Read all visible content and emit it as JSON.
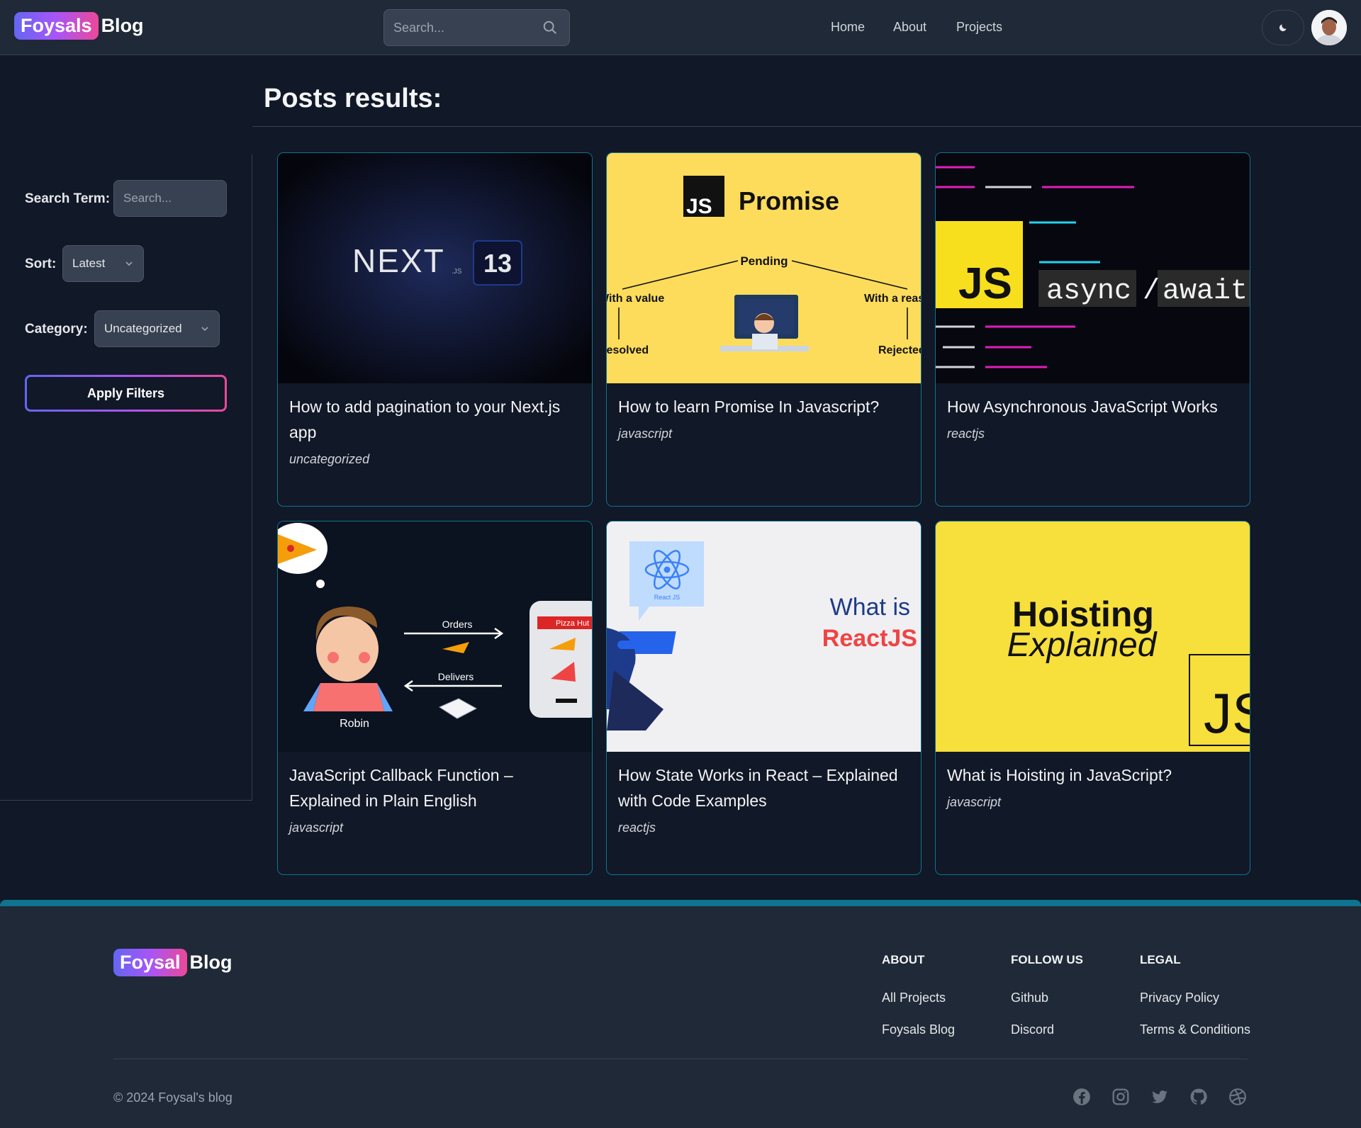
{
  "header": {
    "logo_badge": "Foysals",
    "logo_text": "Blog",
    "search_placeholder": "Search...",
    "nav": [
      "Home",
      "About",
      "Projects"
    ]
  },
  "sidebar": {
    "search_label": "Search Term:",
    "search_placeholder": "Search...",
    "sort_label": "Sort:",
    "sort_value": "Latest",
    "category_label": "Category:",
    "category_value": "Uncategorized",
    "apply_label": "Apply Filters"
  },
  "main": {
    "title": "Posts results:",
    "posts": [
      {
        "title": "How to add pagination to your Next.js app",
        "category": "uncategorized",
        "thumb": "nextjs-13-banner"
      },
      {
        "title": "How to learn Promise In Javascript?",
        "category": "javascript",
        "thumb": "js-promise-diagram"
      },
      {
        "title": "How Asynchronous JavaScript Works",
        "category": "reactjs",
        "thumb": "js-async-await"
      },
      {
        "title": "JavaScript Callback Function –Explained in Plain English",
        "category": "javascript",
        "thumb": "pizza-callback-illustration"
      },
      {
        "title": "How State Works in React – Explained with Code Examples",
        "category": "reactjs",
        "thumb": "what-is-reactjs"
      },
      {
        "title": "What is Hoisting in JavaScript?",
        "category": "javascript",
        "thumb": "hoisting-explained"
      }
    ],
    "thumb_text": {
      "next": "NEXT",
      "next_js": ".JS",
      "next_ver": "13",
      "js": "JS",
      "promise": "Promise",
      "pending": "Pending",
      "with_value": "With a value",
      "with_reason": "With a reason",
      "resolved": "Resolved",
      "rejected": "Rejected",
      "async": "async",
      "slash": "/",
      "await": "await",
      "orders": "Orders",
      "delivers": "Delivers",
      "robin": "Robin",
      "pizza_hut": "Pizza Hut",
      "what_is": "What is",
      "reactjs": "ReactJS",
      "react_js_small": "React JS",
      "hoisting": "Hoisting",
      "explained": "Explained"
    }
  },
  "footer": {
    "logo_badge": "Foysal",
    "logo_text": "Blog",
    "columns": [
      {
        "heading": "ABOUT",
        "links": [
          "All Projects",
          "Foysals Blog"
        ]
      },
      {
        "heading": "FOLLOW US",
        "links": [
          "Github",
          "Discord"
        ]
      },
      {
        "heading": "LEGAL",
        "links": [
          "Privacy Policy",
          "Terms & Conditions"
        ]
      }
    ],
    "copyright": "© 2024 Foysal's blog",
    "social_icons": [
      "facebook-icon",
      "instagram-icon",
      "twitter-icon",
      "github-icon",
      "dribbble-icon"
    ]
  },
  "colors": {
    "accent_gradient": [
      "#6366f1",
      "#a855f7",
      "#ec4899"
    ],
    "card_border": "#0e7490",
    "page_bg": "#111827",
    "header_bg": "#1f2937"
  }
}
